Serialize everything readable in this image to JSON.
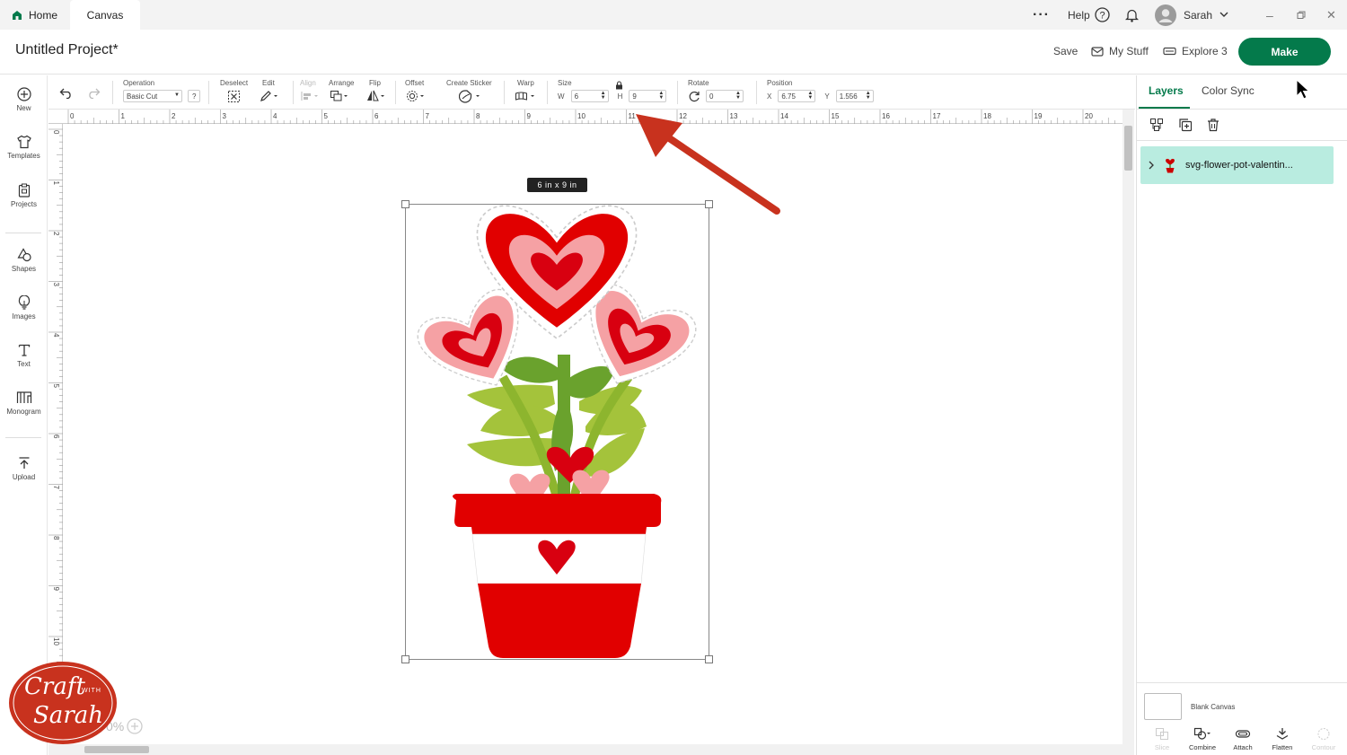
{
  "tabs": {
    "home": "Home",
    "canvas": "Canvas"
  },
  "top": {
    "help": "Help",
    "user": "Sarah"
  },
  "project": {
    "title": "Untitled Project*",
    "save": "Save",
    "my_stuff": "My Stuff",
    "machine": "Explore 3",
    "make": "Make"
  },
  "toolbar": {
    "operation_label": "Operation",
    "operation_value": "Basic Cut",
    "deselect": "Deselect",
    "edit": "Edit",
    "align": "Align",
    "arrange": "Arrange",
    "flip": "Flip",
    "offset": "Offset",
    "create_sticker": "Create Sticker",
    "warp": "Warp",
    "size_label": "Size",
    "w_label": "W",
    "w_value": "6",
    "h_label": "H",
    "h_value": "9",
    "rotate_label": "Rotate",
    "rotate_value": "0",
    "position_label": "Position",
    "x_label": "X",
    "x_value": "6.75",
    "y_label": "Y",
    "y_value": "1.556"
  },
  "leftnav": [
    "New",
    "Templates",
    "Projects",
    "Shapes",
    "Images",
    "Text",
    "Monogram",
    "Upload"
  ],
  "ruler": {
    "h": [
      "0",
      "1",
      "2",
      "3",
      "4",
      "5",
      "6",
      "7",
      "8",
      "9",
      "10",
      "11",
      "12",
      "13",
      "14",
      "15",
      "16",
      "17",
      "18",
      "19",
      "20"
    ],
    "v": [
      "0",
      "1",
      "2",
      "3",
      "4",
      "5",
      "6",
      "7",
      "8",
      "9",
      "10"
    ]
  },
  "canvas": {
    "size_tag": "6 in x 9 in",
    "zoom": "0%"
  },
  "panel": {
    "tab_layers": "Layers",
    "tab_color_sync": "Color Sync",
    "layer_name": "svg-flower-pot-valentin...",
    "blank_canvas": "Blank Canvas",
    "tools": [
      "Slice",
      "Combine",
      "Attach",
      "Flatten",
      "Contour"
    ]
  },
  "logo": {
    "line1": "Craft",
    "with": "WITH",
    "line2": "Sarah"
  },
  "colors": {
    "accent": "#047a4b",
    "layer_highlight": "#b9ece0",
    "heart_red": "#e10000",
    "heart_pink": "#f5a1a4",
    "arrow": "#c8321e"
  }
}
